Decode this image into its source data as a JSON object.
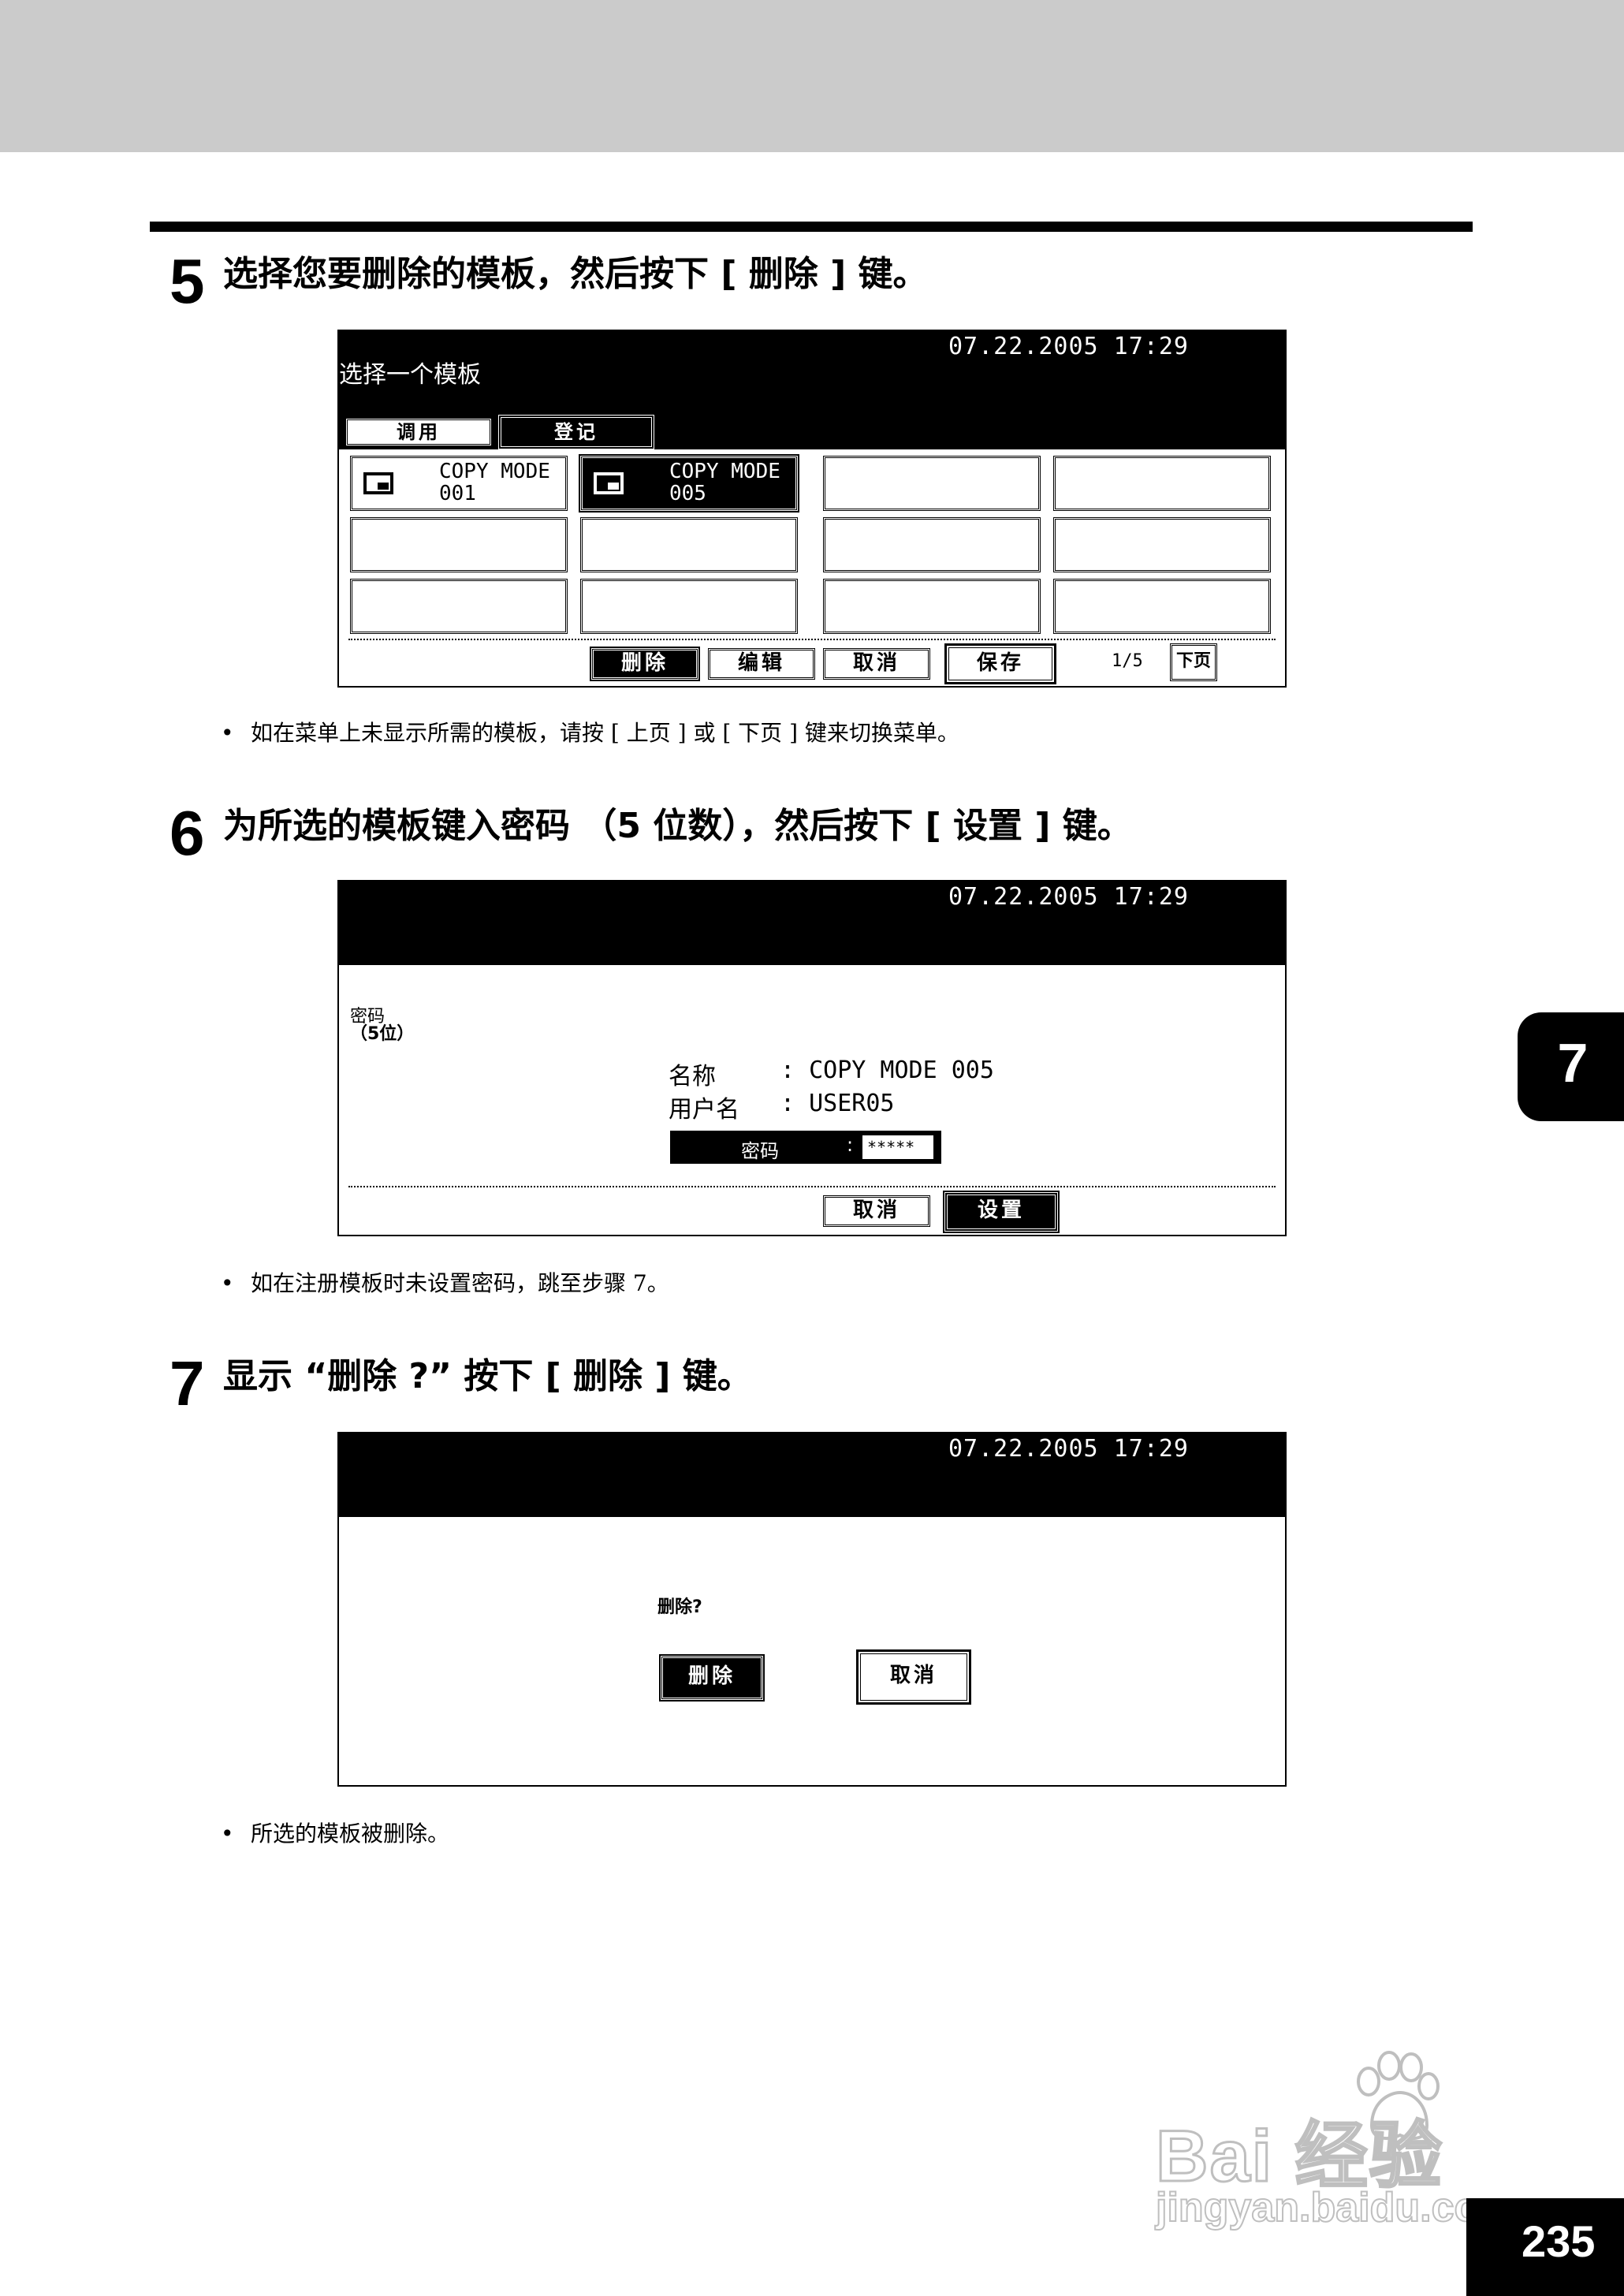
{
  "step5": {
    "number": "5",
    "text": "选择您要删除的模板，然后按下 [ 删除 ] 键。",
    "screen": {
      "datetime": "07.22.2005 17:29",
      "title": "选择一个模板",
      "tabs": [
        "调用",
        "登记"
      ],
      "cells": [
        {
          "name": "COPY MODE 001",
          "line1": "COPY MODE",
          "line2": "001"
        },
        {
          "name": "COPY MODE 005",
          "line1": "COPY MODE",
          "line2": "005"
        }
      ],
      "buttons": {
        "delete": "删除",
        "edit": "编辑",
        "cancel": "取消",
        "save": "保存"
      },
      "page": "1/5",
      "next": "下页"
    },
    "note": "如在菜单上未显示所需的模板，请按 [ 上页 ] 或 [ 下页 ] 键来切换菜单。"
  },
  "step6": {
    "number": "6",
    "text": "为所选的模板键入密码 （5 位数），然后按下 [ 设置 ] 键。",
    "screen": {
      "datetime": "07.22.2005 17:29",
      "label_line1": "密码",
      "label_line2": "（5位）",
      "name_label": "名称",
      "name_value": ": COPY MODE 005",
      "user_label": "用户名",
      "user_value": ": USER05",
      "password_label": "密码",
      "password_sep": ":",
      "password_value": "*****",
      "buttons": {
        "cancel": "取消",
        "set": "设置"
      }
    },
    "note": "如在注册模板时未设置密码，跳至步骤 7。"
  },
  "step7": {
    "number": "7",
    "text": "显示 “删除 ?” 按下 [ 删除 ] 键。",
    "screen": {
      "datetime": "07.22.2005 17:29",
      "prompt": "删除?",
      "buttons": {
        "delete": "删除",
        "cancel": "取消"
      }
    },
    "note": "所选的模板被删除。"
  },
  "chapter_tab": "7",
  "page_number": "235",
  "watermark": {
    "brand": "Bai 经验",
    "url": "jingyan.baidu.com"
  }
}
